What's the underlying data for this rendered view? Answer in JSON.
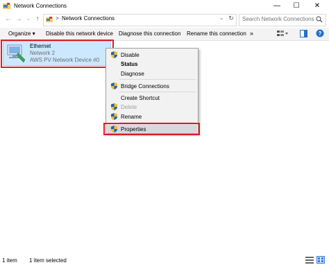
{
  "window": {
    "title": "Network Connections",
    "minimize_glyph": "—",
    "maximize_glyph": "☐",
    "close_glyph": "✕"
  },
  "address": {
    "back_glyph": "←",
    "forward_glyph": "→",
    "recent_glyph": "⌄",
    "up_glyph": "↑",
    "separator": ">",
    "path": "Network Connections",
    "dropdown_glyph": "⌄",
    "refresh_glyph": "↻",
    "search_placeholder": "Search Network Connections"
  },
  "toolbar": {
    "organize": "Organize ▾",
    "disable": "Disable this network device",
    "diagnose": "Diagnose this connection",
    "rename": "Rename this connection",
    "more": "»"
  },
  "item": {
    "name": "Ethernet",
    "network": "Network  2",
    "device": "AWS PV Network Device #0"
  },
  "context_menu": {
    "disable": "Disable",
    "status": "Status",
    "diagnose": "Diagnose",
    "bridge": "Bridge Connections",
    "shortcut": "Create Shortcut",
    "delete": "Delete",
    "rename": "Rename",
    "properties": "Properties"
  },
  "status": {
    "count": "1 item",
    "selected": "1 item selected"
  },
  "colors": {
    "selection": "#cce8ff",
    "annotation": "#e01b24",
    "shield_blue": "#1f5fbf",
    "shield_yellow": "#f2c318"
  },
  "icons": [
    "network-folder-icon",
    "network-adapter-icon",
    "shield-icon",
    "search-icon",
    "view-icon",
    "details-pane-icon",
    "help-icon"
  ]
}
